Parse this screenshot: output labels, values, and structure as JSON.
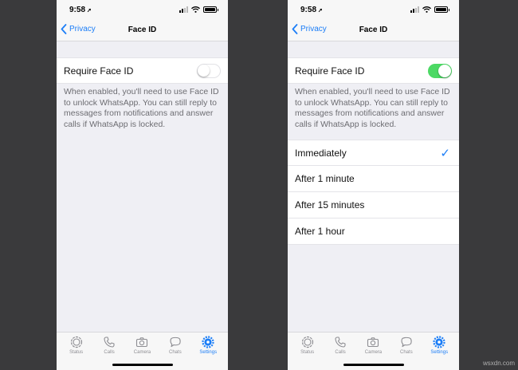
{
  "status": {
    "time": "9:58",
    "location_glyph": "➚"
  },
  "nav": {
    "back_label": "Privacy",
    "title": "Face ID"
  },
  "setting": {
    "label": "Require Face ID",
    "footnote": "When enabled, you'll need to use Face ID to unlock WhatsApp. You can still reply to messages from notifications and answer calls if WhatsApp is locked."
  },
  "left": {
    "toggle_state": "off"
  },
  "right": {
    "toggle_state": "on",
    "options": [
      "Immediately",
      "After 1 minute",
      "After 15 minutes",
      "After 1 hour"
    ],
    "selected_option": "Immediately",
    "check_glyph": "✓"
  },
  "tabs": [
    {
      "label": "Status",
      "icon": "status-icon"
    },
    {
      "label": "Calls",
      "icon": "phone-icon"
    },
    {
      "label": "Camera",
      "icon": "camera-icon"
    },
    {
      "label": "Chats",
      "icon": "chat-icon"
    },
    {
      "label": "Settings",
      "icon": "gear-icon",
      "active": true
    }
  ],
  "colors": {
    "accent": "#1c7ef7",
    "toggle_on": "#4cd964",
    "background": "#efeff4"
  },
  "watermark": "wsxdn.com"
}
